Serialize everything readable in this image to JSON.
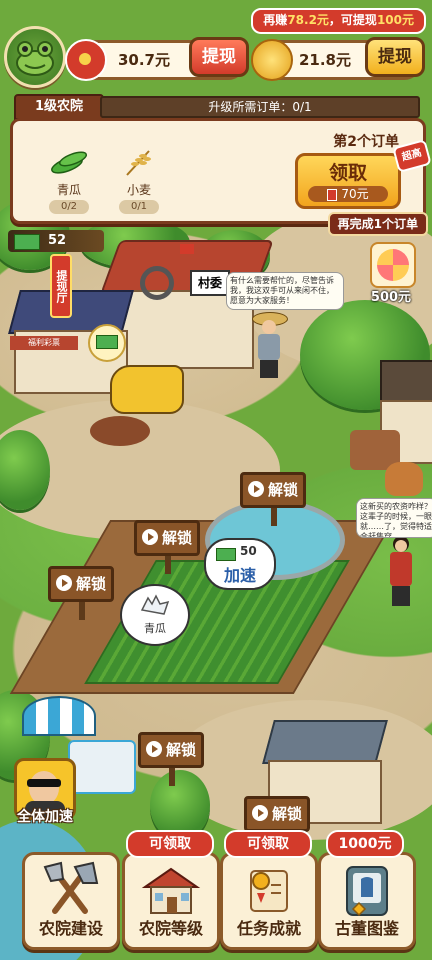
{
  "header": {
    "earn_prefix": "再赚",
    "earn_amount": "78.2元",
    "earn_middle": "，可提现",
    "earn_target": "100元",
    "cash_balance": "30.7元",
    "cash_withdraw_label": "提现",
    "gold_balance": "21.8元",
    "gold_withdraw_label": "提现"
  },
  "level": {
    "name": "1级农院",
    "progress_text": "升级所需订单：0/1",
    "progress": 0
  },
  "order": {
    "title": "第2个订单",
    "items": [
      {
        "name": "青瓜",
        "count": "0/2",
        "icon": "cucumber-icon"
      },
      {
        "name": "小麦",
        "count": "0/1",
        "icon": "wheat-icon"
      }
    ],
    "claim_label": "领取",
    "reward": "70元",
    "badge": "超高",
    "remaining": "再完成1个订单"
  },
  "scene": {
    "cash_count": "52",
    "reward_500": "500元",
    "village_sign": "村委",
    "shop_sign": "福利彩票",
    "pavilion_sign": "提现厅",
    "npc_speech": "有什么需要帮忙的，尽管告诉我，我这双手可从来闲不住，愿意为大家服务！",
    "npc2_speech": "这新买的农资咋样？这辈子的时候，一眼就……了，觉得特适合赶集穿……",
    "unlock_label": "解锁",
    "speed_cash": "50",
    "speed_label": "加速",
    "crop_bubble": "青瓜",
    "speed_all_label": "全体加速"
  },
  "menu": [
    {
      "label": "农院建设",
      "tag": "",
      "icon": "axe-icon"
    },
    {
      "label": "农院等级",
      "tag": "可领取",
      "icon": "farmhouse-icon"
    },
    {
      "label": "任务成就",
      "tag": "可领取",
      "icon": "scroll-icon"
    },
    {
      "label": "古董图鉴",
      "tag": "1000元",
      "icon": "antique-icon"
    }
  ],
  "colors": {
    "accent_red": "#d33b2b",
    "panel_brown": "#7a3b1e",
    "gold": "#f2a41d"
  }
}
